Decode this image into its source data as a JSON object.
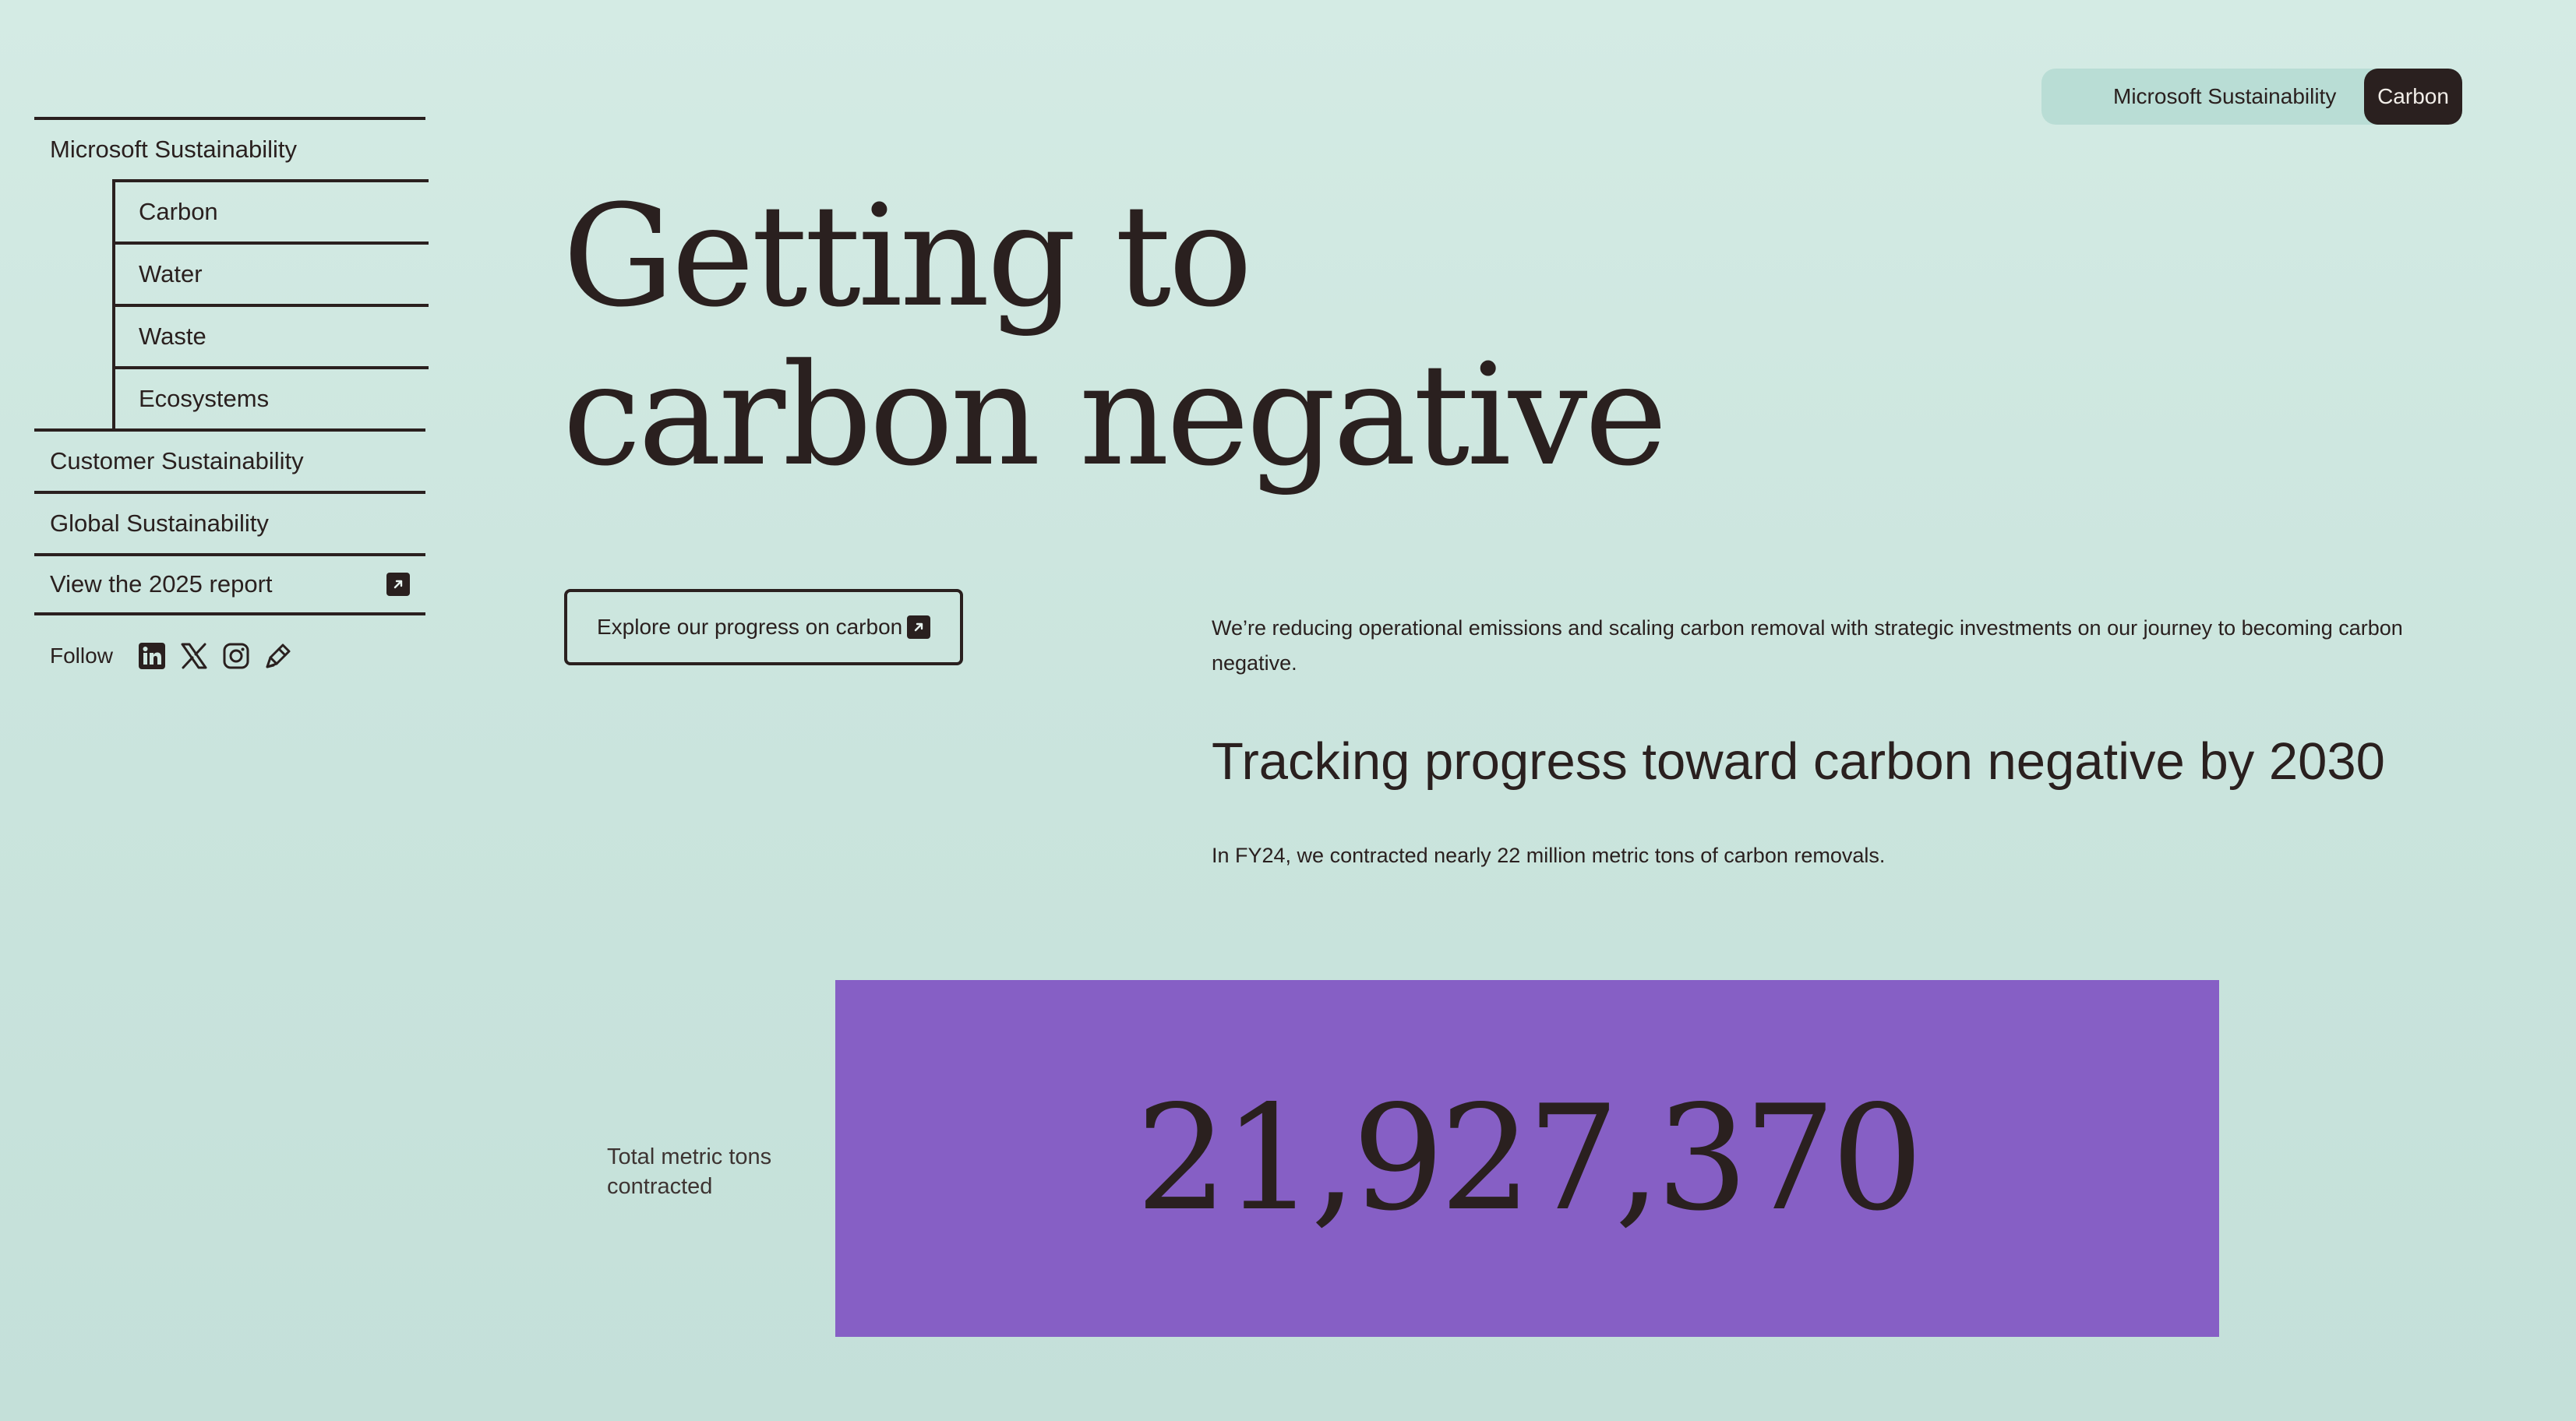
{
  "sidebar": {
    "top_item": "Microsoft Sustainability",
    "sub_items": [
      "Carbon",
      "Water",
      "Waste",
      "Ecosystems"
    ],
    "items_after": [
      "Customer Sustainability",
      "Global Sustainability"
    ],
    "report_link": "View the 2025 report",
    "follow_label": "Follow",
    "social_icons": [
      "linkedin-icon",
      "x-icon",
      "instagram-icon",
      "blog-icon"
    ]
  },
  "topnav": {
    "ms_label": "Microsoft Sustainability",
    "carbon_label": "Carbon"
  },
  "hero": {
    "title_line1": "Getting to",
    "title_line2": "carbon negative",
    "cta_label": "Explore our progress on carbon",
    "intro": "We’re reducing operational emissions and scaling carbon removal with strategic investments on our journey to becoming carbon negative.",
    "tracking_heading": "Tracking progress toward carbon negative by 2030",
    "fy24_text": "In FY24, we contracted nearly 22 million metric tons of carbon removals."
  },
  "stat": {
    "label": "Total metric tons contracted",
    "value": "21,927,370"
  },
  "colors": {
    "background": "#d4ebe4",
    "ink": "#2a201f",
    "stat_box": "#865fc5",
    "pill_bg": "#b9ddd5"
  }
}
